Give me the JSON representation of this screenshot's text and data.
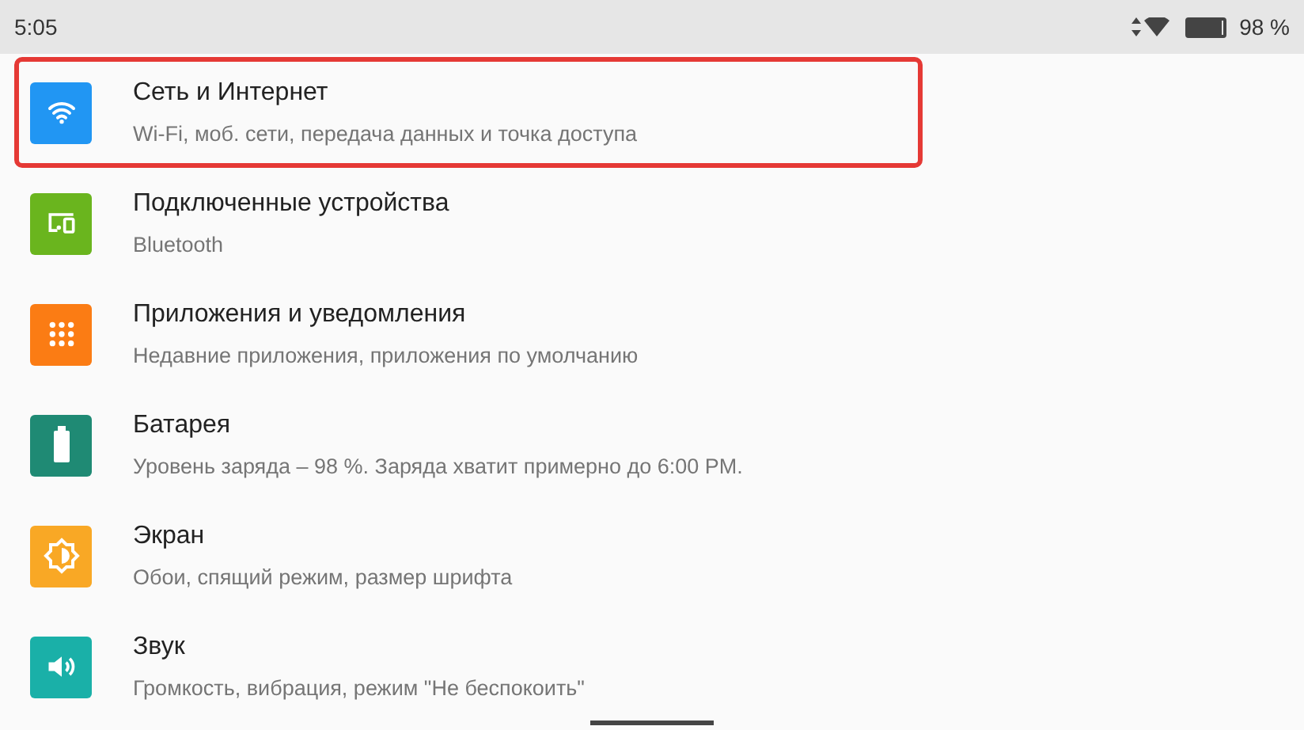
{
  "status_bar": {
    "time": "5:05",
    "level": 0.95,
    "battery_text": "98 %"
  },
  "settings": [
    {
      "kind": "wifi",
      "color": "#2196f3",
      "title": "Сеть и Интернет",
      "subtitle": "Wi-Fi, моб. сети, передача данных и точка доступа",
      "highlighted": true
    },
    {
      "kind": "devices",
      "color": "#6ab51e",
      "title": "Подключенные устройства",
      "subtitle": "Bluetooth",
      "highlighted": false
    },
    {
      "kind": "apps",
      "color": "#fb7c14",
      "title": "Приложения и уведомления",
      "subtitle": "Недавние приложения, приложения по умолчанию",
      "highlighted": false
    },
    {
      "kind": "battery",
      "color": "#1f8a74",
      "title": "Батарея",
      "subtitle": "Уровень заряда – 98 %. Заряда хватит примерно до 6:00 PM.",
      "highlighted": false
    },
    {
      "kind": "display",
      "color": "#f9a825",
      "title": "Экран",
      "subtitle": "Обои, спящий режим, размер шрифта",
      "highlighted": false
    },
    {
      "kind": "sound",
      "color": "#1ab0a8",
      "title": "Звук",
      "subtitle": "Громкость, вибрация, режим \"Не беспокоить\"",
      "highlighted": false
    }
  ]
}
